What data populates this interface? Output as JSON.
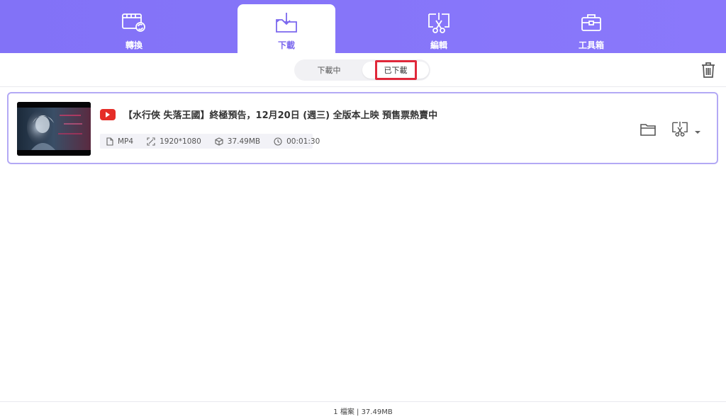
{
  "nav": {
    "tabs": [
      {
        "label": "轉換",
        "icon": "convert-icon"
      },
      {
        "label": "下載",
        "icon": "download-icon",
        "active": true
      },
      {
        "label": "編輯",
        "icon": "edit-icon"
      },
      {
        "label": "工具箱",
        "icon": "toolbox-icon"
      }
    ]
  },
  "subbar": {
    "segments": [
      "下載中",
      "已下載"
    ],
    "selected": "已下載",
    "highlight_color": "#e0283a"
  },
  "items": [
    {
      "source_icon": "youtube-icon",
      "title": "【水行俠 失落王國】終極預告，12月20日 (週三) 全版本上映 預售票熱賣中",
      "format": "MP4",
      "resolution": "1920*1080",
      "size": "37.49MB",
      "duration": "00:01:30"
    }
  ],
  "footer": {
    "summary": "1 檔案 | 37.49MB"
  },
  "colors": {
    "accent": "#7b68ee",
    "youtube": "#e52d27",
    "card_border": "#b3a9f5"
  }
}
